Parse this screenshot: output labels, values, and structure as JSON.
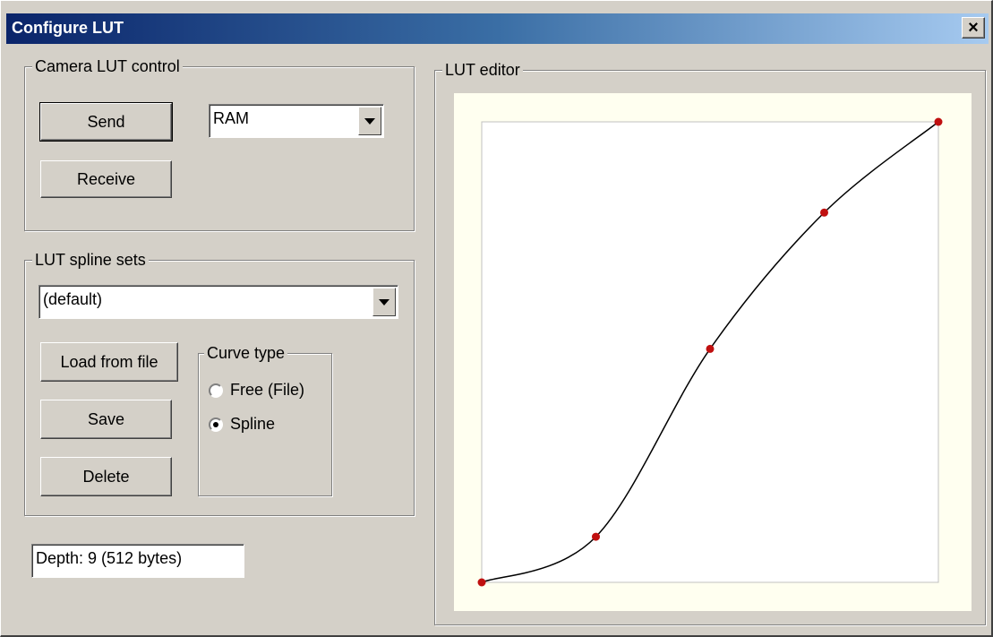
{
  "window": {
    "title": "Configure LUT",
    "close_label": "×"
  },
  "camera_lut_control": {
    "label": "Camera LUT control",
    "send_label": "Send",
    "receive_label": "Receive",
    "target_value": "RAM"
  },
  "lut_spline_sets": {
    "label": "LUT spline sets",
    "selected_set": "(default)",
    "load_label": "Load from file",
    "save_label": "Save",
    "delete_label": "Delete",
    "curve_type": {
      "label": "Curve type",
      "options": [
        "Free (File)",
        "Spline"
      ],
      "selected": "Spline"
    }
  },
  "depth_text": "Depth: 9 (512 bytes)",
  "lut_editor": {
    "label": "LUT editor",
    "control_points": [
      [
        0.0,
        0.0
      ],
      [
        0.25,
        0.099
      ],
      [
        0.5,
        0.507
      ],
      [
        0.75,
        0.803
      ],
      [
        1.0,
        1.0
      ]
    ],
    "point_color": "#c01010",
    "curve_color": "#000000"
  }
}
